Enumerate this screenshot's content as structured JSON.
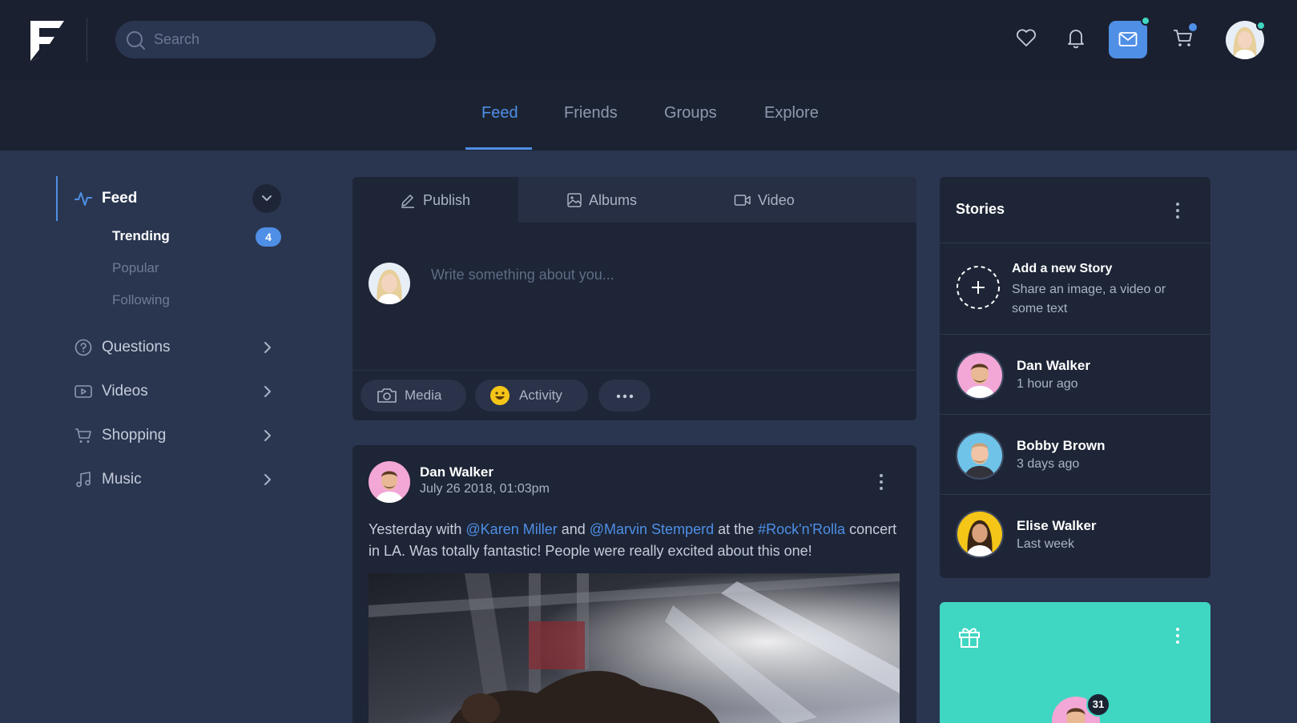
{
  "brand": {
    "logo_letter": "F",
    "accent": "#4f8fe6",
    "teal": "#3fd6c2"
  },
  "search": {
    "placeholder": "Search",
    "value": ""
  },
  "topbar": {
    "icons": [
      "heart-icon",
      "bell-icon",
      "mail-icon",
      "cart-icon"
    ]
  },
  "nav": {
    "tabs": [
      "Feed",
      "Friends",
      "Groups",
      "Explore"
    ],
    "active": "Feed"
  },
  "left_menu": {
    "feed_label": "Feed",
    "sub_items": [
      {
        "label": "Trending",
        "badge": "4",
        "active": true
      },
      {
        "label": "Popular"
      },
      {
        "label": "Following"
      }
    ],
    "items": [
      {
        "label": "Questions",
        "icon": "question-icon"
      },
      {
        "label": "Videos",
        "icon": "video-play-icon"
      },
      {
        "label": "Shopping",
        "icon": "cart-icon"
      },
      {
        "label": "Music",
        "icon": "music-icon"
      }
    ]
  },
  "composer": {
    "tabs": [
      "Publish",
      "Albums",
      "Video"
    ],
    "active_tab": "Publish",
    "placeholder": "Write something about you...",
    "actions": [
      "Media",
      "Activity"
    ]
  },
  "post": {
    "author": "Dan Walker",
    "date": "July 26 2018, 01:03pm",
    "text_parts": [
      "Yesterday with ",
      "@Karen Miller",
      " and ",
      "@Marvin Stemperd",
      " at the ",
      "#Rock'n'Rolla",
      " concert in LA. Was totally fantastic! People were really excited about this one!"
    ]
  },
  "stories": {
    "title": "Stories",
    "add_title": "Add a new Story",
    "add_sub": "Share an image, a video or some text",
    "items": [
      {
        "name": "Dan Walker",
        "time": "1 hour ago"
      },
      {
        "name": "Bobby Brown",
        "time": "3 days ago"
      },
      {
        "name": "Elise Walker",
        "time": "Last week"
      }
    ]
  },
  "birthday_card": {
    "badge": "31"
  }
}
